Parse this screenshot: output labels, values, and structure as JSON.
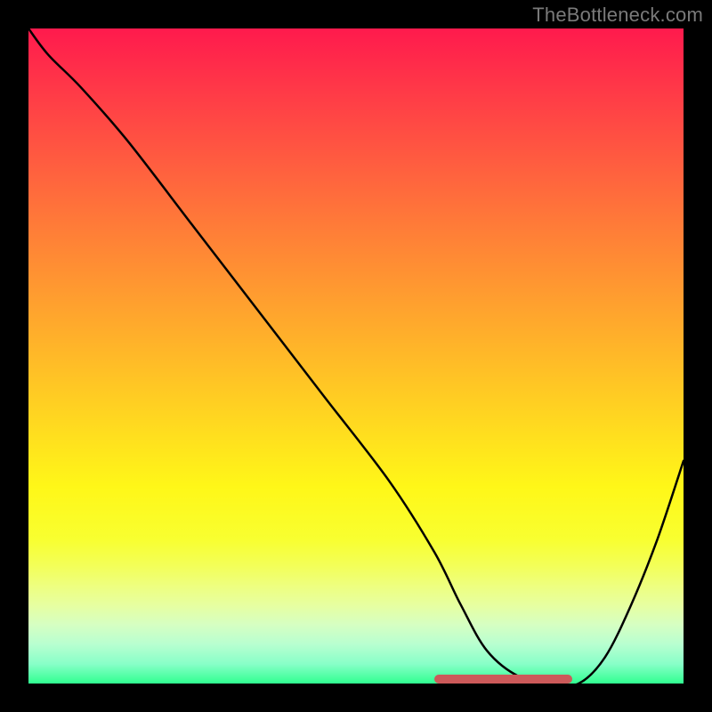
{
  "watermark": "TheBottleneck.com",
  "chart_data": {
    "type": "line",
    "title": "",
    "xlabel": "",
    "ylabel": "",
    "xlim": [
      0,
      100
    ],
    "ylim": [
      0,
      100
    ],
    "grid": false,
    "background": "gradient-red-yellow-green",
    "series": [
      {
        "name": "curve",
        "color": "#000000",
        "x": [
          0,
          3,
          8,
          15,
          25,
          35,
          45,
          55,
          62,
          66,
          70,
          75,
          80,
          84,
          88,
          92,
          96,
          100
        ],
        "y": [
          100,
          96,
          91,
          83,
          70,
          57,
          44,
          31,
          20,
          12,
          5,
          1,
          0,
          0,
          4,
          12,
          22,
          34
        ]
      }
    ],
    "highlight": {
      "name": "flat-bottom",
      "color": "#cc5a5a",
      "x_start": 62,
      "x_end": 83,
      "y": 0
    },
    "gradient_stops": [
      {
        "pos": 0,
        "color": "#ff1a4d"
      },
      {
        "pos": 50,
        "color": "#ffb928"
      },
      {
        "pos": 80,
        "color": "#f8ff30"
      },
      {
        "pos": 100,
        "color": "#30ff90"
      }
    ]
  }
}
